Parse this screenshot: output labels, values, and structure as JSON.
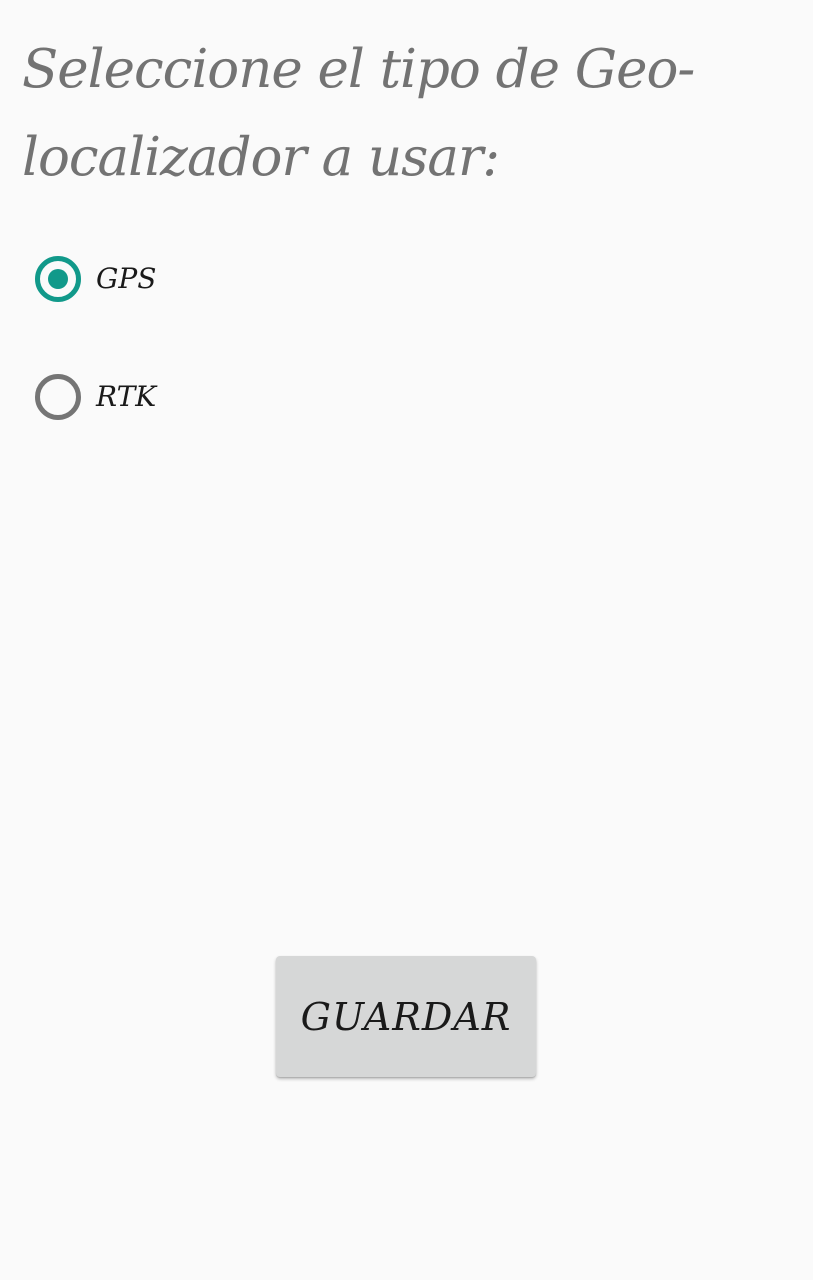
{
  "title": "Seleccione el tipo de Geo-localizador a usar:",
  "radio_group": {
    "options": [
      {
        "label": "GPS",
        "checked": true
      },
      {
        "label": "RTK",
        "checked": false
      }
    ]
  },
  "save_button": {
    "label": "GUARDAR"
  },
  "colors": {
    "accent": "#11998a",
    "unchecked": "#757575",
    "title_text": "#737373",
    "button_bg": "#d6d7d7",
    "background": "#fafafa"
  }
}
